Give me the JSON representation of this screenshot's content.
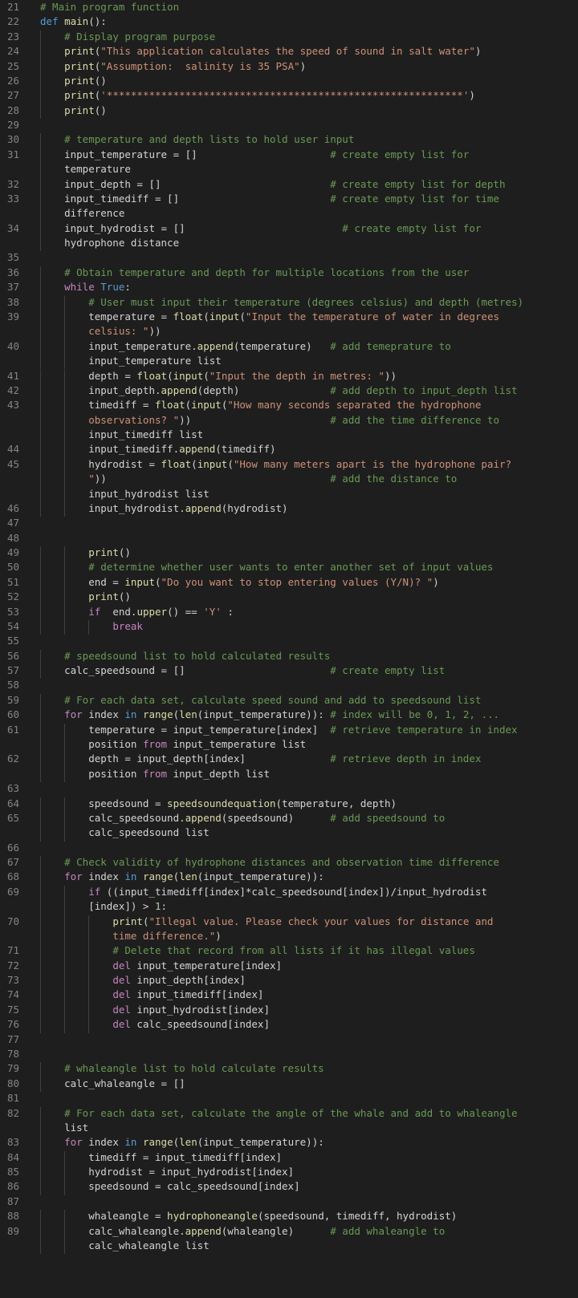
{
  "editor": {
    "lines": [
      {
        "n": "21",
        "text": "# Main program function"
      },
      {
        "n": "22",
        "text": "def main():"
      },
      {
        "n": "23",
        "text": "    # Display program purpose"
      },
      {
        "n": "24",
        "text": "    print(\"This application calculates the speed of sound in salt water\")"
      },
      {
        "n": "25",
        "text": "    print(\"Assumption:  salinity is 35 PSA\")"
      },
      {
        "n": "26",
        "text": "    print()"
      },
      {
        "n": "27",
        "text": "    print('***********************************************************')"
      },
      {
        "n": "28",
        "text": "    print()"
      },
      {
        "n": "29",
        "text": ""
      },
      {
        "n": "30",
        "text": "    # temperature and depth lists to hold user input"
      },
      {
        "n": "31",
        "text": "    input_temperature = []                      # create empty list for"
      },
      {
        "n": "",
        "text": "    temperature"
      },
      {
        "n": "32",
        "text": "    input_depth = []                            # create empty list for depth"
      },
      {
        "n": "33",
        "text": "    input_timediff = []                         # create empty list for time"
      },
      {
        "n": "",
        "text": "    difference"
      },
      {
        "n": "34",
        "text": "    input_hydrodist = []                          # create empty list for"
      },
      {
        "n": "",
        "text": "    hydrophone distance"
      },
      {
        "n": "35",
        "text": ""
      },
      {
        "n": "36",
        "text": "    # Obtain temperature and depth for multiple locations from the user"
      },
      {
        "n": "37",
        "text": "    while True:"
      },
      {
        "n": "38",
        "text": "        # User must input their temperature (degrees celsius) and depth (metres)"
      },
      {
        "n": "39",
        "text": "        temperature = float(input(\"Input the temperature of water in degrees"
      },
      {
        "n": "",
        "text": "        celsius: \"))"
      },
      {
        "n": "40",
        "text": "        input_temperature.append(temperature)   # add temeprature to"
      },
      {
        "n": "",
        "text": "        input_temperature list"
      },
      {
        "n": "41",
        "text": "        depth = float(input(\"Input the depth in metres: \"))"
      },
      {
        "n": "42",
        "text": "        input_depth.append(depth)               # add depth to input_depth list"
      },
      {
        "n": "43",
        "text": "        timediff = float(input(\"How many seconds separated the hydrophone"
      },
      {
        "n": "",
        "text": "        observations? \"))                       # add the time difference to"
      },
      {
        "n": "",
        "text": "        input_timediff list"
      },
      {
        "n": "44",
        "text": "        input_timediff.append(timediff)"
      },
      {
        "n": "45",
        "text": "        hydrodist = float(input(\"How many meters apart is the hydrophone pair?"
      },
      {
        "n": "",
        "text": "        \"))                                     # add the distance to"
      },
      {
        "n": "",
        "text": "        input_hydrodist list"
      },
      {
        "n": "46",
        "text": "        input_hydrodist.append(hydrodist)"
      },
      {
        "n": "47",
        "text": ""
      },
      {
        "n": "48",
        "text": ""
      },
      {
        "n": "49",
        "text": "        print()"
      },
      {
        "n": "50",
        "text": "        # determine whether user wants to enter another set of input values"
      },
      {
        "n": "51",
        "text": "        end = input(\"Do you want to stop entering values (Y/N)? \")"
      },
      {
        "n": "52",
        "text": "        print()"
      },
      {
        "n": "53",
        "text": "        if  end.upper() == 'Y' :"
      },
      {
        "n": "54",
        "text": "            break"
      },
      {
        "n": "55",
        "text": ""
      },
      {
        "n": "56",
        "text": "    # speedsound list to hold calculated results"
      },
      {
        "n": "57",
        "text": "    calc_speedsound = []                        # create empty list"
      },
      {
        "n": "58",
        "text": ""
      },
      {
        "n": "59",
        "text": "    # For each data set, calculate speed sound and add to speedsound list"
      },
      {
        "n": "60",
        "text": "    for index in range(len(input_temperature)): # index will be 0, 1, 2, ..."
      },
      {
        "n": "61",
        "text": "        temperature = input_temperature[index]  # retrieve temperature in index"
      },
      {
        "n": "",
        "text": "        position from input_temperature list"
      },
      {
        "n": "62",
        "text": "        depth = input_depth[index]              # retrieve depth in index"
      },
      {
        "n": "",
        "text": "        position from input_depth list"
      },
      {
        "n": "63",
        "text": ""
      },
      {
        "n": "64",
        "text": "        speedsound = speedsoundequation(temperature, depth)"
      },
      {
        "n": "65",
        "text": "        calc_speedsound.append(speedsound)      # add speedsound to"
      },
      {
        "n": "",
        "text": "        calc_speedsound list"
      },
      {
        "n": "66",
        "text": ""
      },
      {
        "n": "67",
        "text": "    # Check validity of hydrophone distances and observation time difference"
      },
      {
        "n": "68",
        "text": "    for index in range(len(input_temperature)):"
      },
      {
        "n": "69",
        "text": "        if ((input_timediff[index]*calc_speedsound[index])/input_hydrodist"
      },
      {
        "n": "",
        "text": "        [index]) > 1:"
      },
      {
        "n": "70",
        "text": "            print(\"Illegal value. Please check your values for distance and"
      },
      {
        "n": "",
        "text": "            time difference.\")"
      },
      {
        "n": "71",
        "text": "            # Delete that record from all lists if it has illegal values"
      },
      {
        "n": "72",
        "text": "            del input_temperature[index]"
      },
      {
        "n": "73",
        "text": "            del input_depth[index]"
      },
      {
        "n": "74",
        "text": "            del input_timediff[index]"
      },
      {
        "n": "75",
        "text": "            del input_hydrodist[index]"
      },
      {
        "n": "76",
        "text": "            del calc_speedsound[index]"
      },
      {
        "n": "77",
        "text": ""
      },
      {
        "n": "78",
        "text": ""
      },
      {
        "n": "79",
        "text": "    # whaleangle list to hold calculate results"
      },
      {
        "n": "80",
        "text": "    calc_whaleangle = []"
      },
      {
        "n": "81",
        "text": ""
      },
      {
        "n": "82",
        "text": "    # For each data set, calculate the angle of the whale and add to whaleangle"
      },
      {
        "n": "",
        "text": "    list"
      },
      {
        "n": "83",
        "text": "    for index in range(len(input_temperature)):"
      },
      {
        "n": "84",
        "text": "        timediff = input_timediff[index]"
      },
      {
        "n": "85",
        "text": "        hydrodist = input_hydrodist[index]"
      },
      {
        "n": "86",
        "text": "        speedsound = calc_speedsound[index]"
      },
      {
        "n": "87",
        "text": ""
      },
      {
        "n": "88",
        "text": "        whaleangle = hydrophoneangle(speedsound, timediff, hydrodist)"
      },
      {
        "n": "89",
        "text": "        calc_whaleangle.append(whaleangle)      # add whaleangle to"
      },
      {
        "n": "",
        "text": "        calc_whaleangle list"
      }
    ]
  }
}
